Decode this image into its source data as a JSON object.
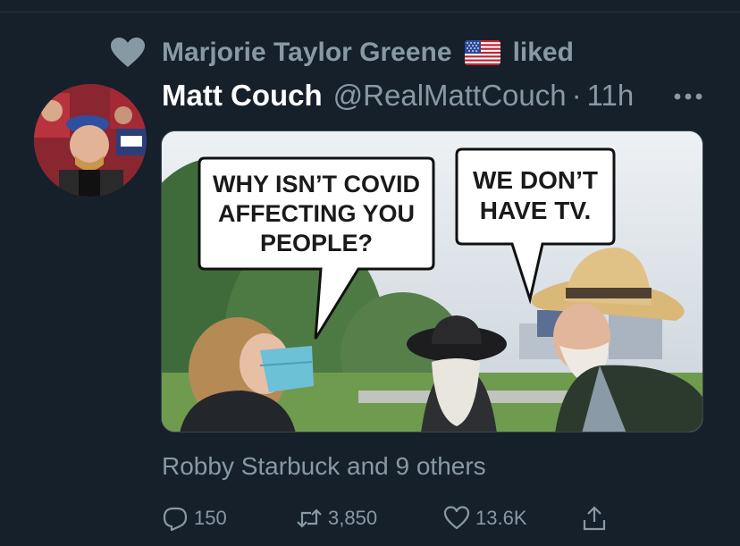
{
  "social_context": {
    "liker_name": "Marjorie Taylor Greene",
    "liker_flag": "us-flag-emoji",
    "action_text": "liked"
  },
  "tweet": {
    "display_name": "Matt Couch",
    "handle": "@RealMattCouch",
    "separator": "·",
    "timestamp": "11h",
    "avatar": "profile-photo",
    "media": {
      "left_bubble": [
        "WHY ISN’T COVID",
        "AFFECTING YOU",
        "PEOPLE?"
      ],
      "right_bubble": [
        "WE DON’T",
        "HAVE TV."
      ]
    },
    "liked_by_summary": "Robby Starbuck and 9 others",
    "actions": {
      "replies": "150",
      "retweets": "3,850",
      "likes": "13.6K"
    }
  },
  "icons": {
    "liked_icon": "heart-icon",
    "more": "ellipsis-icon",
    "reply": "reply-icon",
    "retweet": "retweet-icon",
    "like": "like-icon",
    "share": "share-icon"
  },
  "colors": {
    "background": "#15202b",
    "secondary_text": "#8899a6",
    "divider": "#38444d"
  }
}
